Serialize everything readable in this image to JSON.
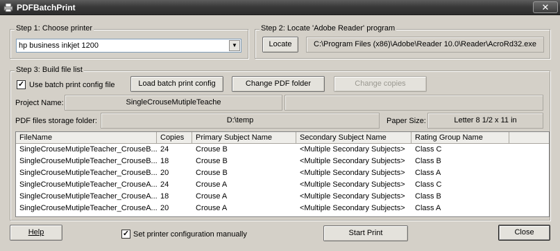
{
  "window": {
    "title": "PDFBatchPrint",
    "close_glyph": "✕"
  },
  "step1": {
    "legend": "Step 1: Choose printer",
    "printer_selected": "hp business inkjet 1200"
  },
  "step2": {
    "legend": "Step 2: Locate 'Adobe Reader' program",
    "locate_label": "Locate",
    "reader_path": "C:\\Program Files (x86)\\Adobe\\Reader 10.0\\Reader\\AcroRd32.exe"
  },
  "step3": {
    "legend": "Step 3: Build file list",
    "use_config_label": "Use batch print config file",
    "use_config_checked": true,
    "load_config_label": "Load batch print config",
    "change_folder_label": "Change PDF folder",
    "change_copies_label": "Change copies",
    "project_name_label": "Project Name:",
    "project_name_value": "SingleCrouseMutipleTeache",
    "project_extra_value": "",
    "storage_label": "PDF files storage folder:",
    "storage_value": "D:\\temp",
    "paper_size_label": "Paper Size:",
    "paper_size_value": "Letter 8 1/2 x 11 in"
  },
  "table": {
    "columns": [
      "FileName",
      "Copies",
      "Primary Subject Name",
      "Secondary Subject Name",
      "Rating Group Name"
    ],
    "rows": [
      [
        "SingleCrouseMutipleTeacher_CrouseB...",
        "24",
        "Crouse B",
        "<Multiple Secondary Subjects>",
        "Class C"
      ],
      [
        "SingleCrouseMutipleTeacher_CrouseB...",
        "18",
        "Crouse B",
        "<Multiple Secondary Subjects>",
        "Class B"
      ],
      [
        "SingleCrouseMutipleTeacher_CrouseB...",
        "20",
        "Crouse B",
        "<Multiple Secondary Subjects>",
        "Class A"
      ],
      [
        "SingleCrouseMutipleTeacher_CrouseA...",
        "24",
        "Crouse A",
        "<Multiple Secondary Subjects>",
        "Class C"
      ],
      [
        "SingleCrouseMutipleTeacher_CrouseA...",
        "18",
        "Crouse A",
        "<Multiple Secondary Subjects>",
        "Class B"
      ],
      [
        "SingleCrouseMutipleTeacher_CrouseA...",
        "20",
        "Crouse A",
        "<Multiple Secondary Subjects>",
        "Class A"
      ]
    ]
  },
  "footer": {
    "help_label": "Help",
    "manual_config_label": "Set printer configuration manually",
    "manual_config_checked": true,
    "start_print_label": "Start Print",
    "close_label": "Close"
  }
}
